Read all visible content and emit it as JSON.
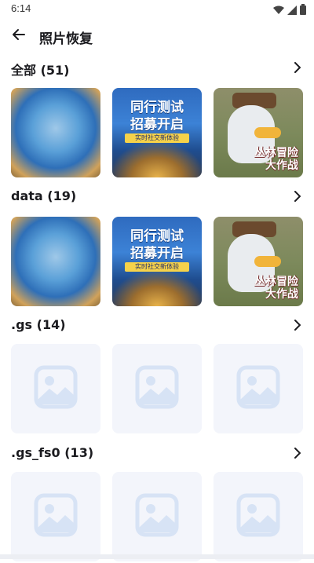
{
  "status_bar": {
    "time": "6:14"
  },
  "header": {
    "title": "照片恢复"
  },
  "sections": [
    {
      "title": "全部 (51)",
      "thumbs": [
        "blurry-photo",
        "game-poster",
        "comic-poster"
      ]
    },
    {
      "title": "data (19)",
      "thumbs": [
        "blurry-photo",
        "game-poster",
        "comic-poster"
      ]
    },
    {
      "title": ".gs (14)",
      "thumbs": [
        "placeholder",
        "placeholder",
        "placeholder"
      ]
    },
    {
      "title": ".gs_fs0 (13)",
      "thumbs": [
        "placeholder",
        "placeholder",
        "placeholder"
      ]
    }
  ],
  "game_poster": {
    "line1": "同行测试",
    "line2": "招募开启",
    "sub": "实时社交新体验"
  },
  "comic_poster": {
    "line1": "丛林冒险",
    "line2": "大作战"
  },
  "colors": {
    "placeholder_bg": "#f3f5fb",
    "placeholder_icon": "#d7e3f5"
  },
  "icons": [
    "back-arrow-icon",
    "chevron-right-icon",
    "image-placeholder-icon",
    "wifi-icon",
    "signal-icon",
    "battery-icon"
  ]
}
